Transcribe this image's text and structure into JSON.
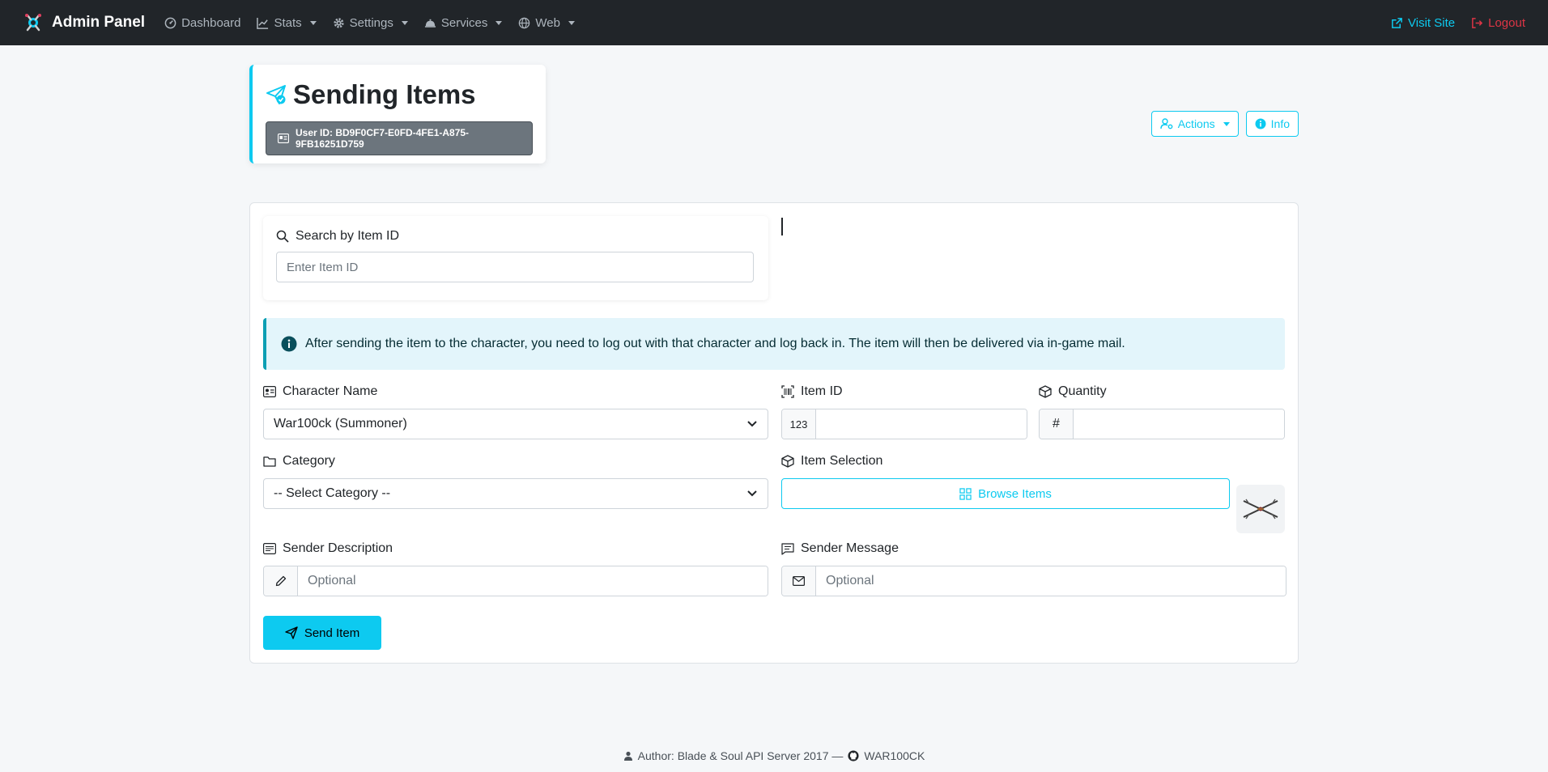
{
  "navbar": {
    "brand": "Admin Panel",
    "items": [
      {
        "label": "Dashboard",
        "icon": "dashboard-icon",
        "dropdown": false
      },
      {
        "label": "Stats",
        "icon": "stats-icon",
        "dropdown": true
      },
      {
        "label": "Settings",
        "icon": "gear-icon",
        "dropdown": true
      },
      {
        "label": "Services",
        "icon": "bell-icon",
        "dropdown": true
      },
      {
        "label": "Web",
        "icon": "globe-icon",
        "dropdown": true
      }
    ],
    "visit_site": "Visit Site",
    "logout": "Logout"
  },
  "header": {
    "title": "Sending Items",
    "user_id": "User ID: BD9F0CF7-E0FD-4FE1-A875-9FB16251D759",
    "actions_label": "Actions",
    "info_label": "Info"
  },
  "search": {
    "label": "Search by Item ID",
    "placeholder": "Enter Item ID",
    "value": ""
  },
  "alert": {
    "text": "After sending the item to the character, you need to log out with that character and log back in. The item will then be delivered via in-game mail."
  },
  "form": {
    "character_label": "Character Name",
    "character_value": "War100ck (Summoner)",
    "item_id_label": "Item ID",
    "item_id_addon": "123",
    "item_id_value": "",
    "quantity_label": "Quantity",
    "quantity_addon": "#",
    "quantity_value": "",
    "category_label": "Category",
    "category_value": "-- Select Category --",
    "item_selection_label": "Item Selection",
    "browse_label": "Browse Items",
    "sender_desc_label": "Sender Description",
    "sender_desc_placeholder": "Optional",
    "sender_msg_label": "Sender Message",
    "sender_msg_placeholder": "Optional",
    "send_label": "Send Item"
  },
  "footer": {
    "author_text": "Author: Blade & Soul API Server 2017 —",
    "github_user": "WAR100CK"
  },
  "colors": {
    "accent": "#0dcaf0",
    "danger": "#dc3545",
    "navbar_bg": "#212529"
  }
}
